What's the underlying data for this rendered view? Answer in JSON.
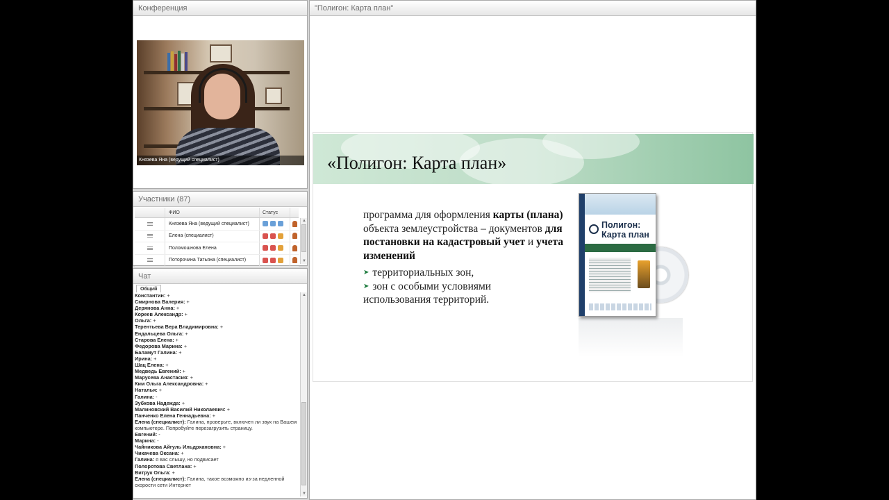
{
  "conference": {
    "title": "Конференция",
    "video_caption": "Князева Яна (ведущий специалист)"
  },
  "participants": {
    "title": "Участники (87)",
    "columns": {
      "name": "ФИО",
      "status": "Статус"
    },
    "rows": [
      {
        "name": "Князева Яна (ведущий специалист)"
      },
      {
        "name": "Елена (специалист)"
      },
      {
        "name": "Поломошнова Елена"
      },
      {
        "name": "Поторочина Татьяна (специалист)"
      }
    ]
  },
  "chat": {
    "title": "Чат",
    "tab": "Общий",
    "messages": [
      {
        "author": "Константин:",
        "text": " +"
      },
      {
        "author": "Смирнова Валерия:",
        "text": " +"
      },
      {
        "author": "Дерянова Анна:",
        "text": " +"
      },
      {
        "author": "Кореев Александр:",
        "text": " +"
      },
      {
        "author": "Ольга:",
        "text": " +"
      },
      {
        "author": "Терентьева Вера  Владимировна:",
        "text": " +"
      },
      {
        "author": "Ендальцева Ольга:",
        "text": " +"
      },
      {
        "author": "Старова Елена:",
        "text": " +"
      },
      {
        "author": "Федорова Марина:",
        "text": " +"
      },
      {
        "author": "Баламут Галина:",
        "text": " +"
      },
      {
        "author": "Ирина:",
        "text": " +"
      },
      {
        "author": "Шац Елена:",
        "text": " +"
      },
      {
        "author": "Медведь Евгений:",
        "text": " +"
      },
      {
        "author": "Марусева Анастасия:",
        "text": " +"
      },
      {
        "author": "Ким Ольга  Александровна:",
        "text": " +"
      },
      {
        "author": "Наталья:",
        "text": " +"
      },
      {
        "author": "Галина:",
        "text": " -"
      },
      {
        "author": "Зубкова Надежда:",
        "text": " +"
      },
      {
        "author": "Малиновский Василий  Николаевич:",
        "text": " +"
      },
      {
        "author": "Панченко Елена  Геннадьевна:",
        "text": " +"
      },
      {
        "author": "Елена (специалист):",
        "text": " Галина, проверьте, включен ли звук на Вашем компьютере. Попробуйте перезагрузить страницу."
      },
      {
        "author": "Евгений:",
        "text": " -"
      },
      {
        "author": "Марина:",
        "text": " -"
      },
      {
        "author": "Чайникова Айгуль  Ильдрхановна:",
        "text": " +"
      },
      {
        "author": "Чикачева Оксана:",
        "text": " +"
      },
      {
        "author": "Галина:",
        "text": " я вас слышу, но подвисает"
      },
      {
        "author": "Полоротова Светлана:",
        "text": " +"
      },
      {
        "author": "Витрук Ольга:",
        "text": " +"
      },
      {
        "author": "Елена (специалист):",
        "text": " Галина, такое возможно из-за недленной скорости сети Интернет"
      }
    ]
  },
  "presentation": {
    "title": "\"Полигон: Карта план\"",
    "slide": {
      "heading": "«Полигон: Карта план»",
      "p1": "программа для оформления ",
      "p1_bold1": "карты (плана)",
      "p1_mid": " объекта землеустройства – документов ",
      "p1_bold2": "для постановки на кадастровый учет",
      "p1_and": " и ",
      "p1_bold3": "учета изменений",
      "bullet1": "территориальных зон,",
      "bullet2": "зон с особыми условиями",
      "bullet2_cont": "использования территорий.",
      "product_title": "Полигон: Карта план"
    }
  },
  "colors": {
    "banner_green": "#8ec4a1",
    "bullet_green": "#1a7a3c"
  }
}
